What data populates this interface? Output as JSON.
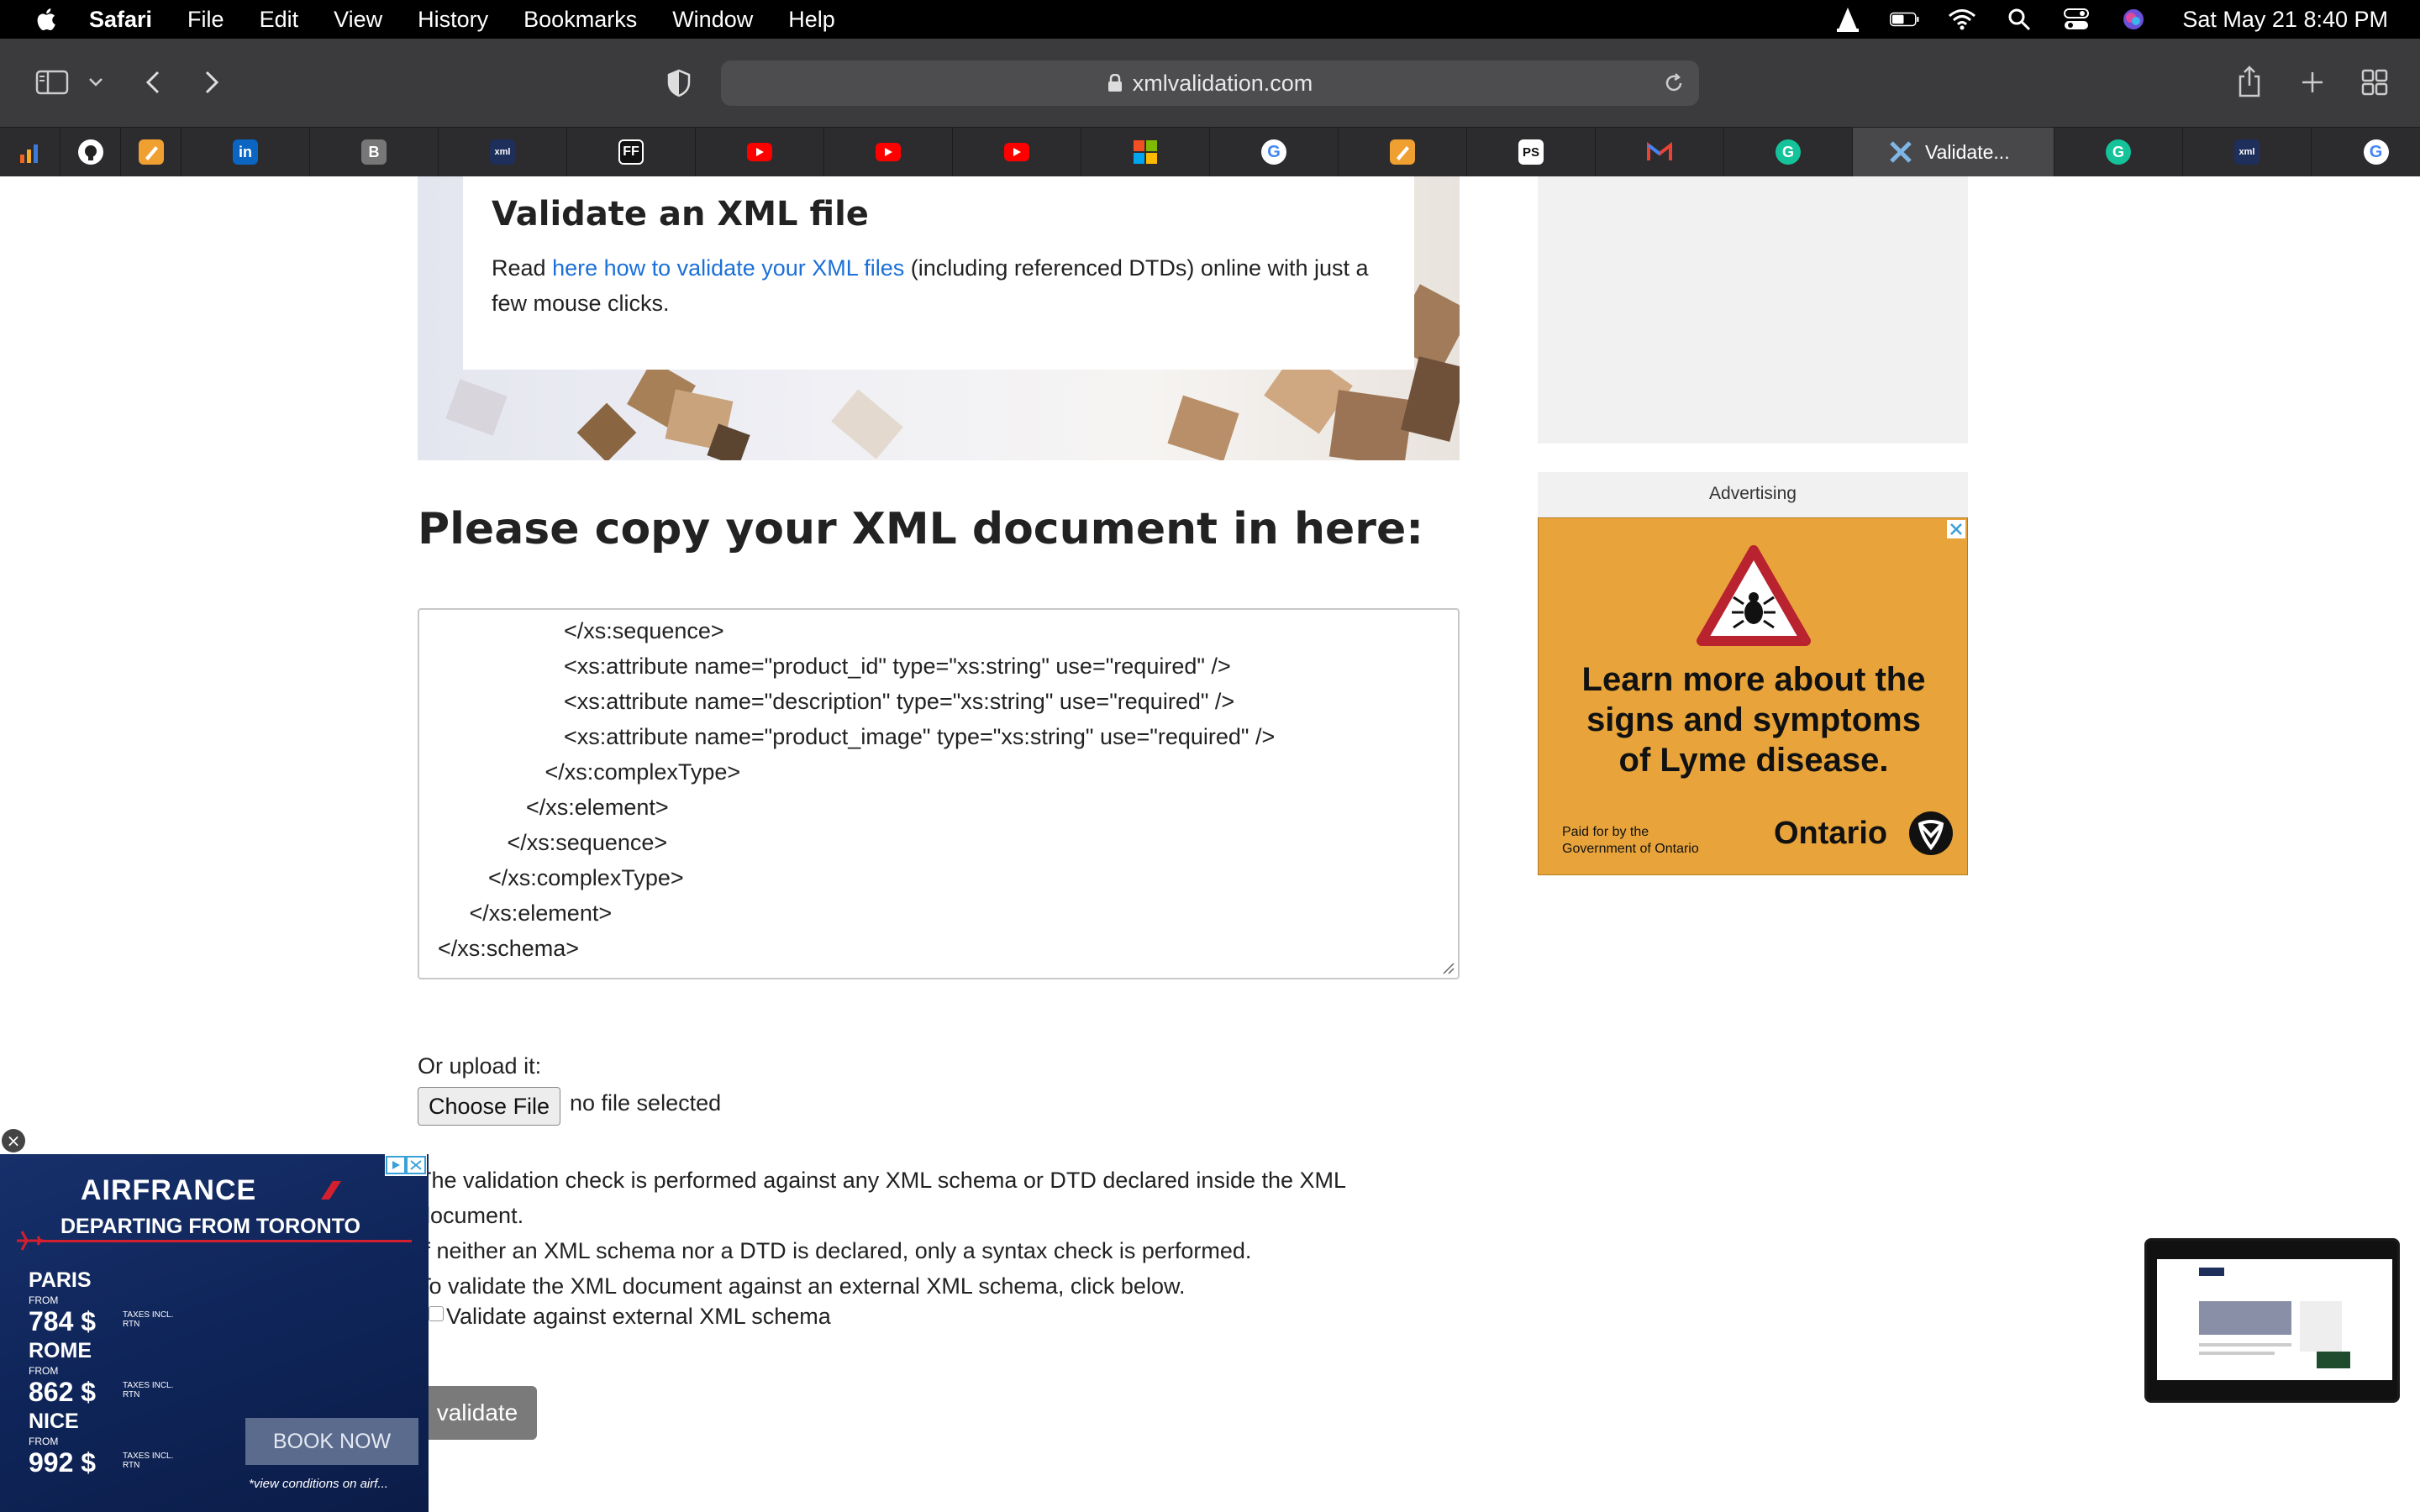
{
  "menubar": {
    "app_name": "Safari",
    "items": [
      "File",
      "Edit",
      "View",
      "History",
      "Bookmarks",
      "Window",
      "Help"
    ],
    "clock": "Sat May 21  8:40 PM",
    "status_icons": [
      "vlc-icon",
      "battery-icon",
      "wifi-icon",
      "spotlight-icon",
      "control-center-icon",
      "siri-icon"
    ]
  },
  "toolbar": {
    "url": "xmlvalidation.com"
  },
  "tabs": [
    {
      "icon": "analytics-icon",
      "label": ""
    },
    {
      "icon": "github-icon",
      "label": ""
    },
    {
      "icon": "notes-icon",
      "label": ""
    },
    {
      "icon": "linkedin-icon",
      "label": ""
    },
    {
      "icon": "b-icon",
      "label": ""
    },
    {
      "icon": "xml-icon",
      "label": ""
    },
    {
      "icon": "ff-icon",
      "label": ""
    },
    {
      "icon": "youtube-icon",
      "label": ""
    },
    {
      "icon": "youtube-icon",
      "label": ""
    },
    {
      "icon": "youtube-icon",
      "label": ""
    },
    {
      "icon": "microsoft-icon",
      "label": ""
    },
    {
      "icon": "google-icon",
      "label": ""
    },
    {
      "icon": "notes-icon",
      "label": ""
    },
    {
      "icon": "playstation-icon",
      "label": ""
    },
    {
      "icon": "gmail-icon",
      "label": ""
    },
    {
      "icon": "grammarly-icon",
      "label": ""
    },
    {
      "icon": "xml-active-icon",
      "label": "Validate..."
    },
    {
      "icon": "grammarly-icon",
      "label": ""
    },
    {
      "icon": "xml-icon",
      "label": ""
    },
    {
      "icon": "google-icon",
      "label": ""
    }
  ],
  "hero": {
    "title": "Validate an XML file",
    "text_before": "Read ",
    "link": "here how to validate your XML files",
    "text_after": " (including referenced DTDs) online with just a few mouse clicks."
  },
  "main": {
    "heading": "Please copy your XML document in here:",
    "xml_lines": [
      "                    </xs:sequence>",
      "                    <xs:attribute name=\"product_id\" type=\"xs:string\" use=\"required\" />",
      "                    <xs:attribute name=\"description\" type=\"xs:string\" use=\"required\" />",
      "                    <xs:attribute name=\"product_image\" type=\"xs:string\" use=\"required\" />",
      "                 </xs:complexType>",
      "              </xs:element>",
      "           </xs:sequence>",
      "        </xs:complexType>",
      "     </xs:element>",
      "</xs:schema>"
    ],
    "upload_label": "Or upload it:",
    "choose_file": "Choose File",
    "no_file": "no file selected",
    "info_lines": [
      "The validation check is performed against any XML schema or DTD declared inside the XML",
      "document.",
      "If neither an XML schema nor a DTD is declared, only a syntax check is performed.",
      "To validate the XML document against an external XML schema, click below."
    ],
    "external_label": "Validate against external XML schema",
    "validate_button": "validate"
  },
  "sidebar": {
    "ad_label": "Advertising",
    "ontario_ad": {
      "headline_1": "Learn more about the",
      "headline_2": "signs and symptoms",
      "headline_3": "of Lyme disease.",
      "paid_1": "Paid for by the",
      "paid_2": "Government of Ontario",
      "brand": "Ontario",
      "bg_color": "#e8a43a"
    }
  },
  "airfrance_ad": {
    "logo": "AIRFRANCE",
    "tagline": "DEPARTING FROM TORONTO",
    "fares": [
      {
        "city": "PARIS",
        "from": "FROM",
        "price": "784 $",
        "tax": "TAXES INCL.\nRTN"
      },
      {
        "city": "ROME",
        "from": "FROM",
        "price": "862 $",
        "tax": "TAXES INCL.\nRTN"
      },
      {
        "city": "NICE",
        "from": "FROM",
        "price": "992 $",
        "tax": "TAXES INCL.\nRTN"
      }
    ],
    "book": "BOOK NOW",
    "conditions": "*view conditions on airf...",
    "close": "×"
  }
}
